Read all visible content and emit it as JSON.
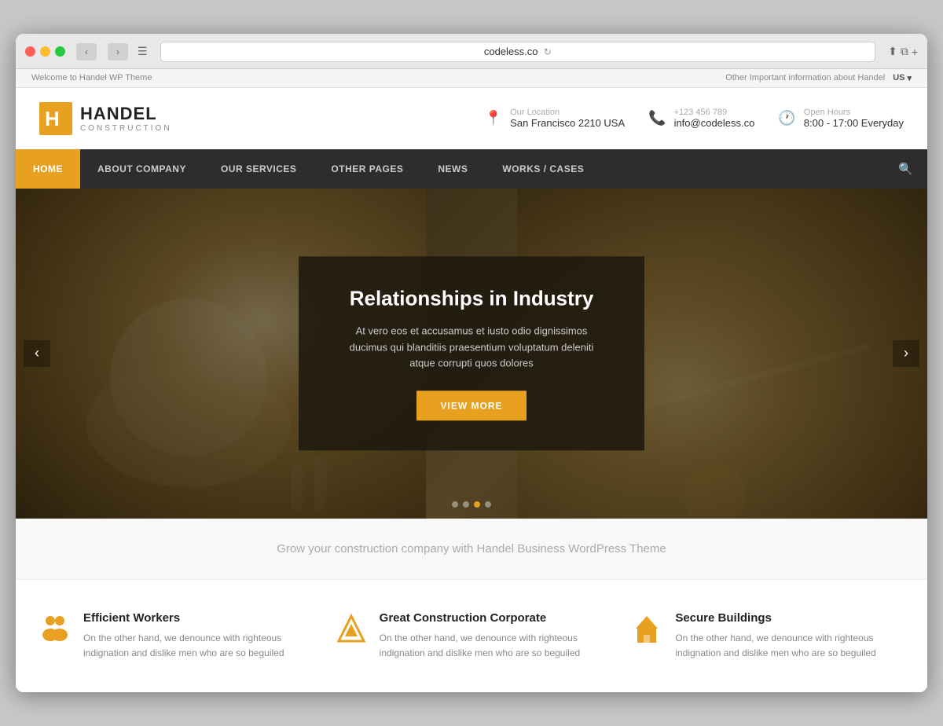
{
  "browser": {
    "url": "codeless.co",
    "traffic_lights": [
      "red",
      "yellow",
      "green"
    ]
  },
  "topbar": {
    "left_text": "Welcome to Handel WP Theme",
    "right_text": "Other Important information about Handel",
    "language": "US"
  },
  "header": {
    "logo_name": "HANDEL",
    "logo_sub": "CONSTRUCTION",
    "contact_items": [
      {
        "icon": "📍",
        "label": "Our Location",
        "value": "San Francisco 2210 USA"
      },
      {
        "icon": "📞",
        "label": "+123 456 789",
        "value": "info@codeless.co"
      },
      {
        "icon": "🕐",
        "label": "Open Hours",
        "value": "8:00 - 17:00 Everyday"
      }
    ]
  },
  "nav": {
    "items": [
      {
        "label": "HOME",
        "active": true
      },
      {
        "label": "ABOUT COMPANY",
        "active": false
      },
      {
        "label": "OUR SERVICES",
        "active": false
      },
      {
        "label": "OTHER PAGES",
        "active": false
      },
      {
        "label": "NEWS",
        "active": false
      },
      {
        "label": "WORKS / CASES",
        "active": false
      }
    ]
  },
  "hero": {
    "title": "Relationships in Industry",
    "description": "At vero eos et accusamus et iusto odio dignissimos ducimus qui blanditiis praesentium voluptatum deleniti atque corrupti quos dolores",
    "button_label": "VIEW MORE",
    "dots": [
      false,
      false,
      true,
      false
    ]
  },
  "tagline": {
    "text": "Grow your construction company with Handel Business WordPress Theme"
  },
  "features": [
    {
      "icon": "👥",
      "title": "Efficient Workers",
      "description": "On the other hand, we denounce with righteous indignation and dislike men who are so beguiled"
    },
    {
      "icon": "◈",
      "title": "Great  Construction Corporate",
      "description": "On the other hand, we denounce with righteous indignation and dislike men who are so beguiled"
    },
    {
      "icon": "🏗️",
      "title": "Secure Buildings",
      "description": "On the other hand, we denounce with righteous indignation and dislike men who are so beguiled"
    }
  ]
}
